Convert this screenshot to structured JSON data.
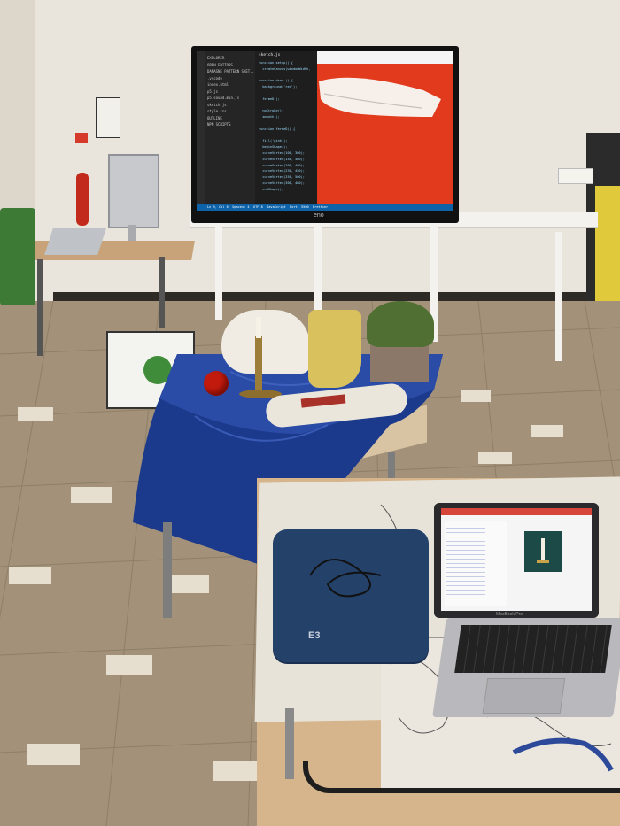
{
  "scene": {
    "kind": "photo",
    "colors": {
      "wall": "#e9e4dc",
      "floor": "#a39279",
      "tablecloth": "#1c3a8c",
      "canvas_red": "#e23a1c",
      "editor_bg": "#1e1e1e",
      "apple_red": "#c21b0e",
      "boot": "#d9c25e",
      "laptop_case": "#24416a"
    }
  },
  "monitor": {
    "brand": "eno",
    "editor": {
      "sidebar_lines": [
        "EXPLORER",
        "OPEN EDITORS",
        "DAMASNE_PATTERN_SKET...",
        ".vscode",
        "index.html",
        "p5.js",
        "p5.sound.min.js",
        "sketch.js",
        "style.css",
        "OUTLINE",
        "NPM SCRIPTS"
      ],
      "tab_label": "sketch.js",
      "code_lines": [
        "function setup() {",
        "  createCanvas(windowWidth,",
        "",
        "function draw () {",
        "  background('red');",
        "",
        "  fermeD();",
        "",
        "  noStroke();",
        "  smooth();",
        "",
        "function fermeD() {",
        "",
        "  fill('pink');",
        "  beginShape();",
        "  curveVertex(100, 300);",
        "  curveVertex(140, 400);",
        "  curveVertex(200, 400);",
        "  curveVertex(230, 450);",
        "  curveVertex(250, 500);",
        "  curveVertex(300, 480);",
        "  endShape();"
      ],
      "status_bar": "Ln 9, Col 6  Spaces: 4  UTF-8  JavaScript  Port: 5500  Prettier"
    }
  },
  "laptop": {
    "brand": "MacBook Pro",
    "case_logo": "E3"
  }
}
